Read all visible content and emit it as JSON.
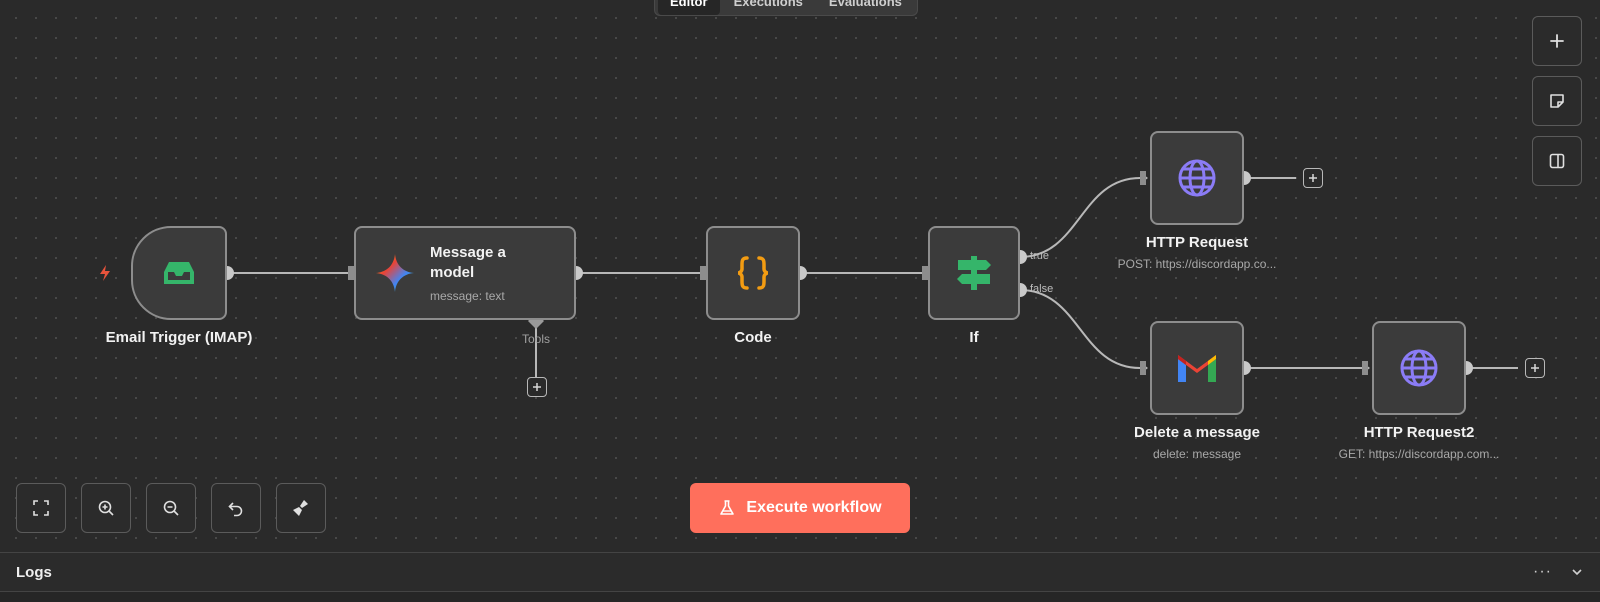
{
  "top_tabs": [
    "Editor",
    "Executions",
    "Evaluations"
  ],
  "nodes": {
    "email_trigger": {
      "title": "Email Trigger (IMAP)",
      "icon": "inbox-icon"
    },
    "message_model": {
      "title": "Message a model",
      "subtitle": "message: text",
      "tools_label": "Tools",
      "icon": "gemini-icon"
    },
    "code": {
      "title": "Code",
      "icon": "braces-icon"
    },
    "if": {
      "title": "If",
      "true_label": "true",
      "false_label": "false",
      "icon": "signpost-icon"
    },
    "http_request": {
      "title": "HTTP Request",
      "subtitle": "POST: https://discordapp.co...",
      "icon": "globe-icon"
    },
    "delete_message": {
      "title": "Delete a message",
      "subtitle": "delete: message",
      "icon": "gmail-icon"
    },
    "http_request2": {
      "title": "HTTP Request2",
      "subtitle": "GET: https://discordapp.com...",
      "icon": "globe-icon"
    }
  },
  "execute_button": {
    "label": "Execute workflow",
    "icon": "flask-icon"
  },
  "controls": [
    "fit-view-icon",
    "zoom-in-icon",
    "zoom-out-icon",
    "undo-icon",
    "tidy-up-icon"
  ],
  "right_tools": [
    "plus-icon",
    "sticky-note-icon",
    "panel-icon"
  ],
  "logs": {
    "title": "Logs"
  },
  "colors": {
    "accent": "#ff6f5c",
    "trigger": "#e8533c",
    "code": "#f39c12",
    "if": "#35b56a",
    "globe": "#8b7cf6"
  }
}
